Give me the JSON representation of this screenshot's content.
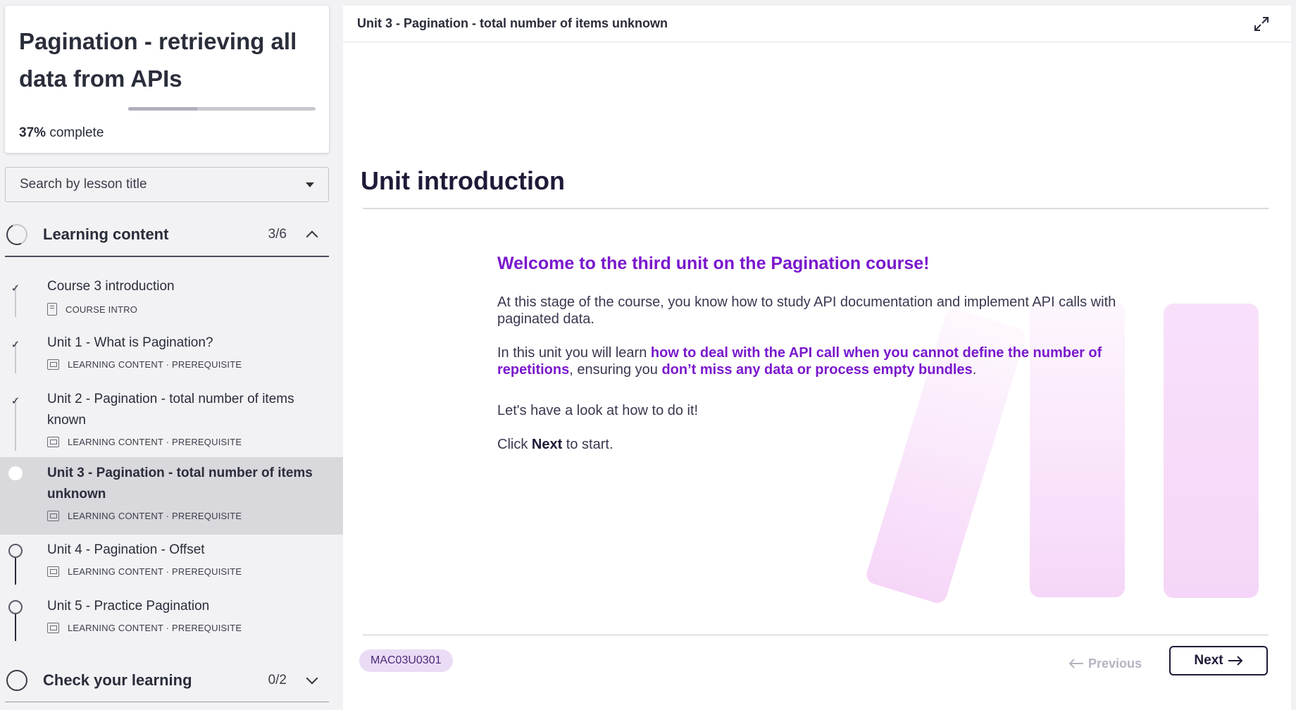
{
  "course": {
    "title": "Pagination - retrieving all data from APIs",
    "progress_percent": 37,
    "progress_pct_label": "37%",
    "progress_suffix": "complete"
  },
  "search": {
    "placeholder": "Search by lesson title"
  },
  "sections": [
    {
      "title": "Learning content",
      "count": "3/6",
      "expanded": true
    },
    {
      "title": "Check your learning",
      "count": "0/2",
      "expanded": false
    }
  ],
  "lessons": [
    {
      "title": "Course 3 introduction",
      "meta": "COURSE INTRO",
      "status": "done"
    },
    {
      "title": "Unit 1 - What is Pagination?",
      "meta": "LEARNING CONTENT · PREREQUISITE",
      "status": "done"
    },
    {
      "title": "Unit 2 - Pagination - total number of items known",
      "meta": "LEARNING CONTENT · PREREQUISITE",
      "status": "done"
    },
    {
      "title": "Unit 3 - Pagination - total number of items unknown",
      "meta": "LEARNING CONTENT · PREREQUISITE",
      "status": "current"
    },
    {
      "title": "Unit 4 - Pagination - Offset",
      "meta": "LEARNING CONTENT · PREREQUISITE",
      "status": "todo"
    },
    {
      "title": "Unit 5 - Practice Pagination",
      "meta": "LEARNING CONTENT · PREREQUISITE",
      "status": "todo"
    }
  ],
  "main": {
    "breadcrumb": "Unit 3 - Pagination - total number of items unknown",
    "heading": "Unit introduction",
    "welcome": "Welcome to the third unit on the Pagination course!",
    "p1": "At this stage of the course, you know how to study API documentation and implement API calls with paginated data.",
    "p2_a": "In this unit you will learn ",
    "p2_b": "how to deal with the API call when you cannot define the number of repetitions",
    "p2_c": ", ensuring you ",
    "p2_d": "don’t miss any data or process empty bundles",
    "p2_e": ".",
    "p3": "Let's have a look at how to do it!",
    "p4_a": "Click ",
    "p4_b": "Next",
    "p4_c": " to start.",
    "code": "MAC03U0301",
    "previous_label": "Previous",
    "next_label": "Next"
  },
  "colors": {
    "accent": "#7a18cc",
    "dark": "#1e1a38",
    "decor": "#f6d6f8"
  },
  "icons": {
    "expand": "expand-icon",
    "check": "check-icon",
    "dropdown": "caret-down-icon"
  }
}
